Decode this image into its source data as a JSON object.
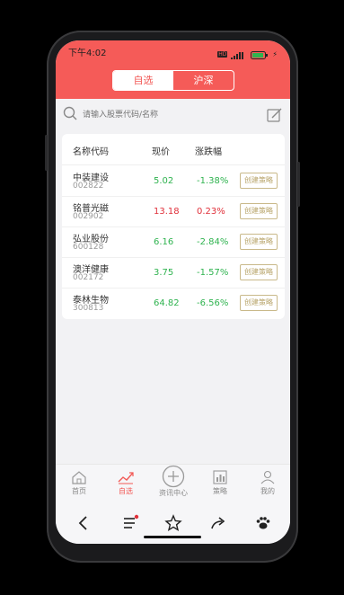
{
  "status": {
    "time": "下午4:02",
    "battery": "90"
  },
  "header": {
    "tabs": [
      "自选",
      "沪深"
    ],
    "active_tab": 0
  },
  "search": {
    "placeholder": "请输入股票代码/名称"
  },
  "table": {
    "columns": [
      "名称代码",
      "现价",
      "涨跌幅"
    ],
    "rows": [
      {
        "name": "中装建设",
        "code": "002822",
        "price": "5.02",
        "change": "-1.38%",
        "action": "创建策略",
        "trend": "down"
      },
      {
        "name": "铭普光磁",
        "code": "002902",
        "price": "13.18",
        "change": "0.23%",
        "action": "创建策略",
        "trend": "up"
      },
      {
        "name": "弘业股份",
        "code": "600128",
        "price": "6.16",
        "change": "-2.84%",
        "action": "创建策略",
        "trend": "down"
      },
      {
        "name": "澳洋健康",
        "code": "002172",
        "price": "3.75",
        "change": "-1.57%",
        "action": "创建策略",
        "trend": "down"
      },
      {
        "name": "泰林生物",
        "code": "300813",
        "price": "64.82",
        "change": "-6.56%",
        "action": "创建策略",
        "trend": "down"
      }
    ]
  },
  "tabbar": {
    "items": [
      {
        "label": "首页",
        "icon": "home-icon"
      },
      {
        "label": "自选",
        "icon": "trend-chart-icon",
        "active": true
      },
      {
        "label": "资讯中心",
        "icon": "plus-circle-icon"
      },
      {
        "label": "策略",
        "icon": "bar-chart-icon"
      },
      {
        "label": "我的",
        "icon": "user-icon"
      }
    ]
  },
  "colors": {
    "brand": "#f55b58",
    "up": "#e0313b",
    "down": "#2fb34f",
    "gold": "#b8a46a"
  }
}
